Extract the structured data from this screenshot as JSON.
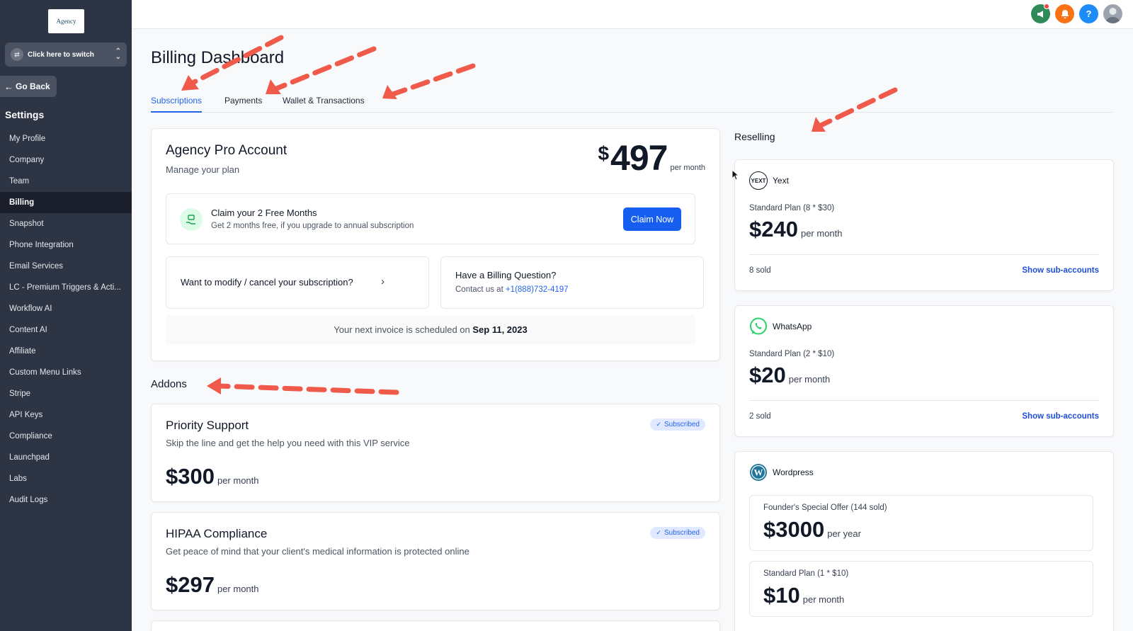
{
  "sidebar": {
    "logo_text": "Agency",
    "switcher_label": "Click here to switch",
    "go_back": "Go Back",
    "settings_title": "Settings",
    "items": [
      {
        "label": "My Profile"
      },
      {
        "label": "Company"
      },
      {
        "label": "Team"
      },
      {
        "label": "Billing",
        "active": true
      },
      {
        "label": "Snapshot"
      },
      {
        "label": "Phone Integration"
      },
      {
        "label": "Email Services"
      },
      {
        "label": "LC - Premium Triggers & Acti..."
      },
      {
        "label": "Workflow AI"
      },
      {
        "label": "Content AI"
      },
      {
        "label": "Affiliate"
      },
      {
        "label": "Custom Menu Links"
      },
      {
        "label": "Stripe"
      },
      {
        "label": "API Keys"
      },
      {
        "label": "Compliance"
      },
      {
        "label": "Launchpad"
      },
      {
        "label": "Labs"
      },
      {
        "label": "Audit Logs"
      }
    ]
  },
  "topbar": {
    "icons": [
      {
        "name": "megaphone-icon",
        "color": "#2e8b57"
      },
      {
        "name": "bell-icon",
        "color": "#f97316"
      },
      {
        "name": "help-icon",
        "color": "#1d8cf8",
        "glyph": "?"
      },
      {
        "name": "avatar",
        "color": "#9ca3af"
      }
    ]
  },
  "page": {
    "title": "Billing Dashboard",
    "tabs": [
      {
        "label": "Subscriptions",
        "active": true
      },
      {
        "label": "Payments"
      },
      {
        "label": "Wallet & Transactions"
      }
    ]
  },
  "plan": {
    "name": "Agency Pro Account",
    "subtitle": "Manage your plan",
    "currency": "$",
    "amount": "497",
    "period": "per month",
    "promo_title": "Claim your 2 Free Months",
    "promo_sub": "Get 2 months free, if you upgrade to annual subscription",
    "claim_button": "Claim Now",
    "modify_text": "Want to modify / cancel your subscription?",
    "billing_q_title": "Have a Billing Question?",
    "billing_q_prefix": "Contact us at",
    "billing_q_phone": "+1(888)732-4197",
    "invoice_prefix": "Your next invoice is scheduled on",
    "invoice_date": "Sep 11, 2023"
  },
  "addons": {
    "title": "Addons",
    "badge_label": "Subscribed",
    "items": [
      {
        "name": "Priority Support",
        "desc": "Skip the line and get the help you need with this VIP service",
        "price": "$300",
        "period": "per month"
      },
      {
        "name": "HIPAA Compliance",
        "desc": "Get peace of mind that your client's medical information is protected online",
        "price": "$297",
        "period": "per month"
      }
    ]
  },
  "reselling": {
    "title": "Reselling",
    "link_label": "Show sub-accounts",
    "yext": {
      "name": "Yext",
      "logo_text": "YEXT",
      "plan": "Standard Plan (8 * $30)",
      "price": "$240",
      "period": "per month",
      "sold": "8 sold"
    },
    "whatsapp": {
      "name": "WhatsApp",
      "plan": "Standard Plan (2 * $10)",
      "price": "$20",
      "period": "per month",
      "sold": "2 sold",
      "color": "#25d366"
    },
    "wordpress": {
      "name": "Wordpress",
      "color": "#21759b",
      "plans": [
        {
          "plan": "Founder's Special Offer (144 sold)",
          "price": "$3000",
          "period": "per year"
        },
        {
          "plan": "Standard Plan (1 * $10)",
          "price": "$10",
          "period": "per month"
        }
      ]
    }
  },
  "colors": {
    "accent": "#155eef",
    "annotation_arrow": "#ef5a4a"
  }
}
